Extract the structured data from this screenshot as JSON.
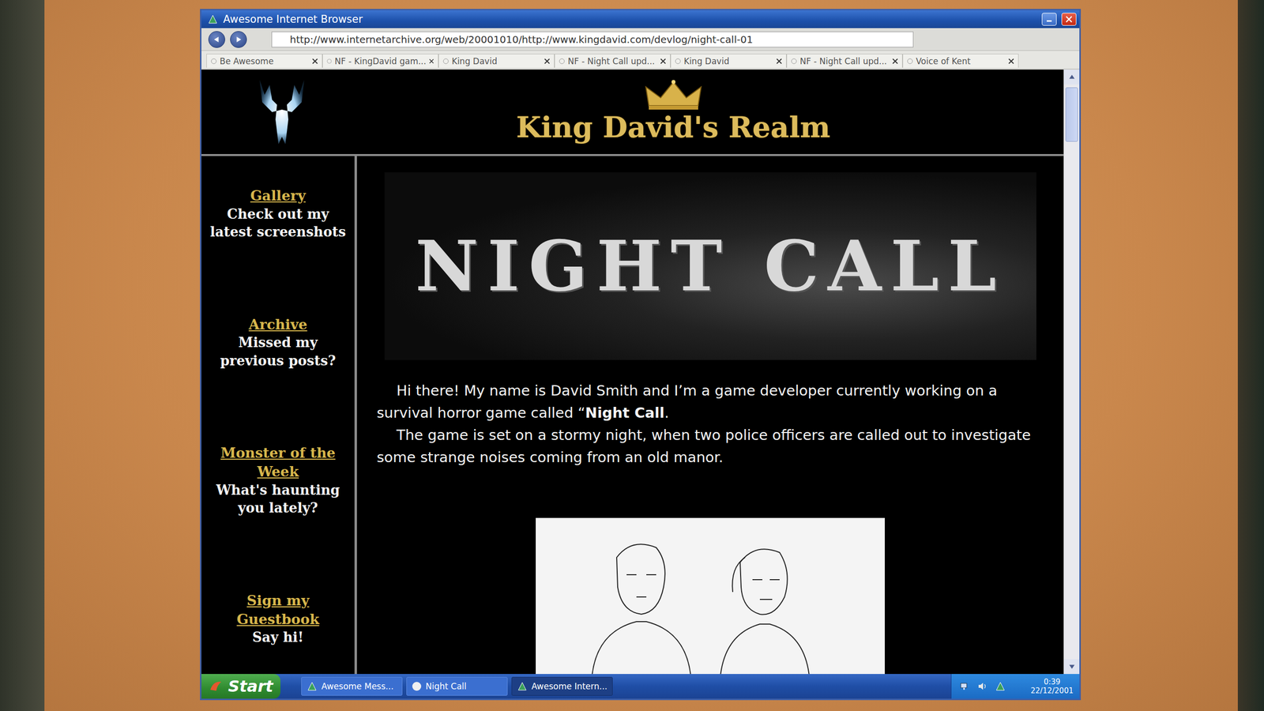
{
  "window": {
    "title": "Awesome Internet Browser"
  },
  "address": {
    "url": "http://www.internetarchive.org/web/20001010/http://www.kingdavid.com/devlog/night-call-01"
  },
  "tabs": [
    {
      "label": "Be Awesome",
      "selected": false
    },
    {
      "label": "NF - KingDavid gam...",
      "selected": false
    },
    {
      "label": "King David",
      "selected": false
    },
    {
      "label": "NF - Night Call upd...",
      "selected": false
    },
    {
      "label": "King David",
      "selected": false
    },
    {
      "label": "NF - Night Call upd...",
      "selected": false
    },
    {
      "label": "Voice of Kent",
      "selected": false
    }
  ],
  "page": {
    "header_title": "King David's Realm",
    "sidebar": [
      {
        "link": "Gallery",
        "caption": "Check out my latest screenshots"
      },
      {
        "link": "Archive",
        "caption": "Missed my previous posts?"
      },
      {
        "link": "Monster of the Week",
        "caption": "What's haunting you lately?"
      },
      {
        "link": "Sign my Guestbook",
        "caption": "Say hi!"
      }
    ],
    "banner_title": "NIGHT CALL",
    "paragraphs": [
      [
        {
          "text": "Hi there! My name is David Smith and I’m a game developer currently working on a survival horror game called “",
          "bold": false
        },
        {
          "text": "Night Call",
          "bold": true
        },
        {
          "text": ".",
          "bold": false
        }
      ],
      [
        {
          "text": "The game is set on a stormy night, when two police officers are called out to investigate some strange noises coming from an old manor.",
          "bold": false
        }
      ]
    ]
  },
  "taskbar": {
    "start": "Start",
    "tasks": [
      {
        "label": "Awesome Mess...",
        "selected": false
      },
      {
        "label": "Night Call",
        "selected": false
      },
      {
        "label": "Awesome Intern...",
        "selected": true
      }
    ],
    "clock": {
      "time": "0:39",
      "date": "22/12/2001"
    }
  }
}
